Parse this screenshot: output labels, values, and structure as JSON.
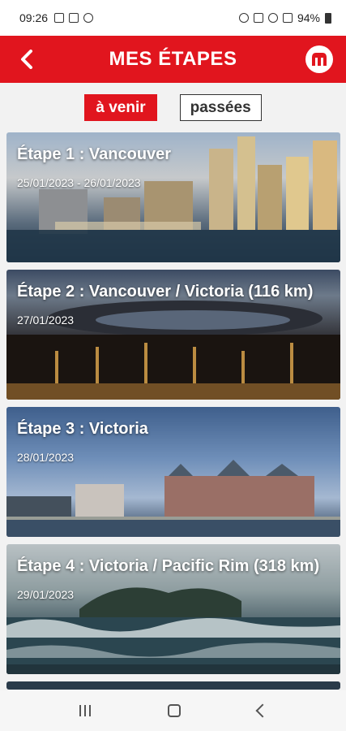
{
  "status_bar": {
    "time": "09:26",
    "battery": "94%"
  },
  "header": {
    "title": "MES ÉTAPES"
  },
  "tabs": [
    {
      "label": "à venir",
      "active": true
    },
    {
      "label": "passées",
      "active": false
    }
  ],
  "stages": [
    {
      "title": "Étape  1 : Vancouver",
      "dates": "25/01/2023 - 26/01/2023"
    },
    {
      "title": "Étape  2 : Vancouver / Victoria  (116 km)",
      "dates": "27/01/2023"
    },
    {
      "title": "Étape  3 : Victoria",
      "dates": "28/01/2023"
    },
    {
      "title": "Étape  4 : Victoria / Pacific Rim (318 km)",
      "dates": "29/01/2023"
    }
  ],
  "colors": {
    "brand_red": "#e1151e",
    "status_bar_bg": "#ffffff",
    "page_bg": "#f2f2f2"
  }
}
